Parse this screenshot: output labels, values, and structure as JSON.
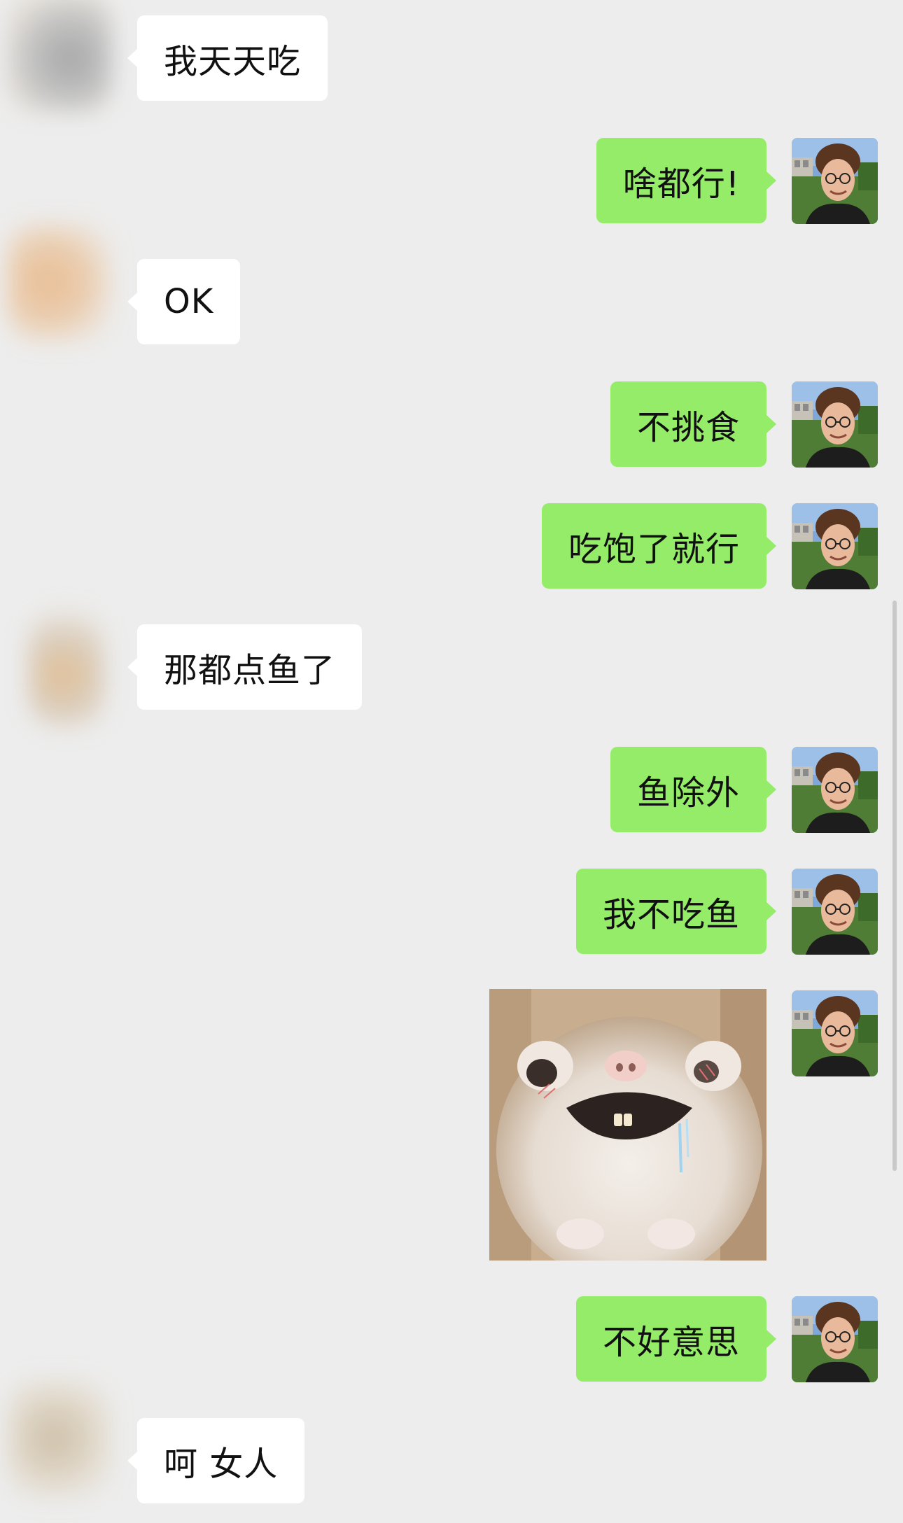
{
  "messages": [
    {
      "id": "m1",
      "side": "in",
      "text": "我天天吃"
    },
    {
      "id": "m2",
      "side": "out",
      "text": "啥都行!"
    },
    {
      "id": "m3",
      "side": "in",
      "text": "OK"
    },
    {
      "id": "m4",
      "side": "out",
      "text": "不挑食"
    },
    {
      "id": "m5",
      "side": "out",
      "text": "吃饱了就行"
    },
    {
      "id": "m6",
      "side": "in",
      "text": "那都点鱼了"
    },
    {
      "id": "m7",
      "side": "out",
      "text": "鱼除外"
    },
    {
      "id": "m8",
      "side": "out",
      "text": "我不吃鱼"
    },
    {
      "id": "m9",
      "side": "out",
      "type": "sticker",
      "icon": "hamster-sticker"
    },
    {
      "id": "m10",
      "side": "out",
      "text": "不好意思"
    },
    {
      "id": "m11",
      "side": "in",
      "text": "呵 女人"
    }
  ],
  "colors": {
    "background": "#ededed",
    "incoming_bubble": "#ffffff",
    "outgoing_bubble": "#95ec69",
    "text": "#111111"
  }
}
